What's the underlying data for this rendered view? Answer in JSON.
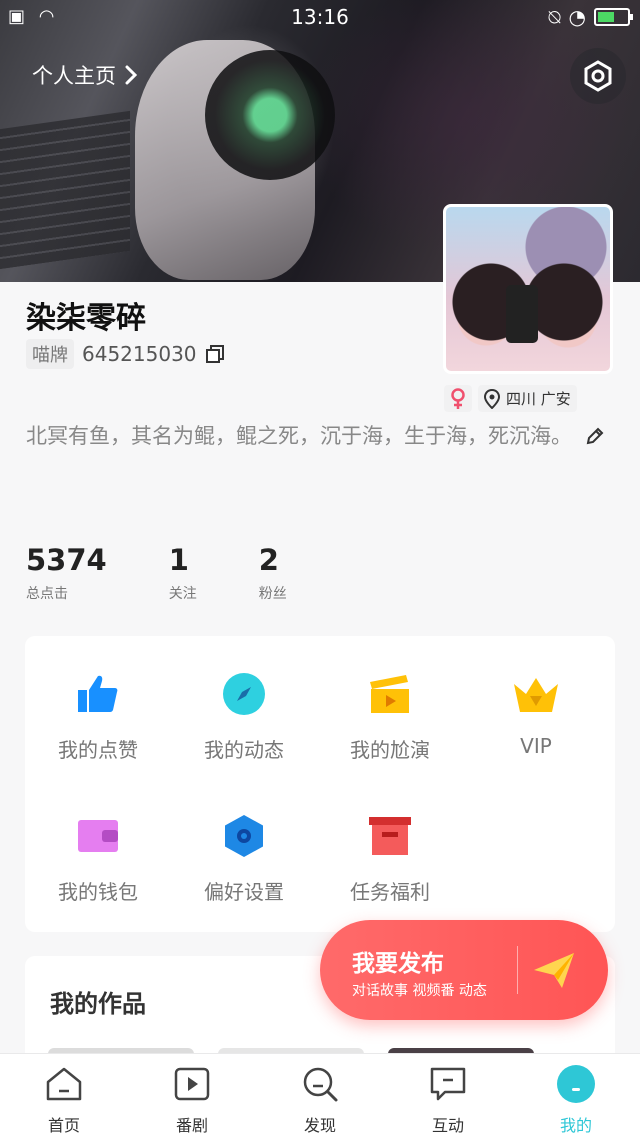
{
  "status_bar": {
    "time": "13:16"
  },
  "header": {
    "home_link": "个人主页"
  },
  "profile": {
    "name": "染柒零碎",
    "id_tag": "喵牌",
    "id_number": "645215030",
    "location": "四川 广安",
    "gender_icon": "female-icon",
    "bio": "北冥有鱼，其名为鲲，鲲之死，沉于海，生于海，死沉海。"
  },
  "stats": [
    {
      "value": "5374",
      "label": "总点击"
    },
    {
      "value": "1",
      "label": "关注"
    },
    {
      "value": "2",
      "label": "粉丝"
    }
  ],
  "menu": [
    {
      "label": "我的点赞",
      "icon": "thumbs-up-icon",
      "color": "#1890ff"
    },
    {
      "label": "我的动态",
      "icon": "compass-icon",
      "color": "#2ed0e0"
    },
    {
      "label": "我的尬演",
      "icon": "clapperboard-icon",
      "color": "#ffc107"
    },
    {
      "label": "VIP",
      "icon": "crown-icon",
      "color": "#ffc107"
    },
    {
      "label": "我的钱包",
      "icon": "wallet-icon",
      "color": "#e57ef0"
    },
    {
      "label": "偏好设置",
      "icon": "hexagon-settings-icon",
      "color": "#1e88e5"
    },
    {
      "label": "任务福利",
      "icon": "gift-box-icon",
      "color": "#f45b5b"
    }
  ],
  "works": {
    "title": "我的作品"
  },
  "fab": {
    "title": "我要发布",
    "subtitle": "对话故事 视频番 动态"
  },
  "bottom_nav": [
    {
      "label": "首页",
      "icon": "home-icon"
    },
    {
      "label": "番剧",
      "icon": "play-box-icon"
    },
    {
      "label": "发现",
      "icon": "search-icon"
    },
    {
      "label": "互动",
      "icon": "chat-icon"
    },
    {
      "label": "我的",
      "icon": "profile-icon",
      "active": true
    }
  ],
  "colors": {
    "accent": "#2ec7d6",
    "fab": "#ff5a5a"
  }
}
